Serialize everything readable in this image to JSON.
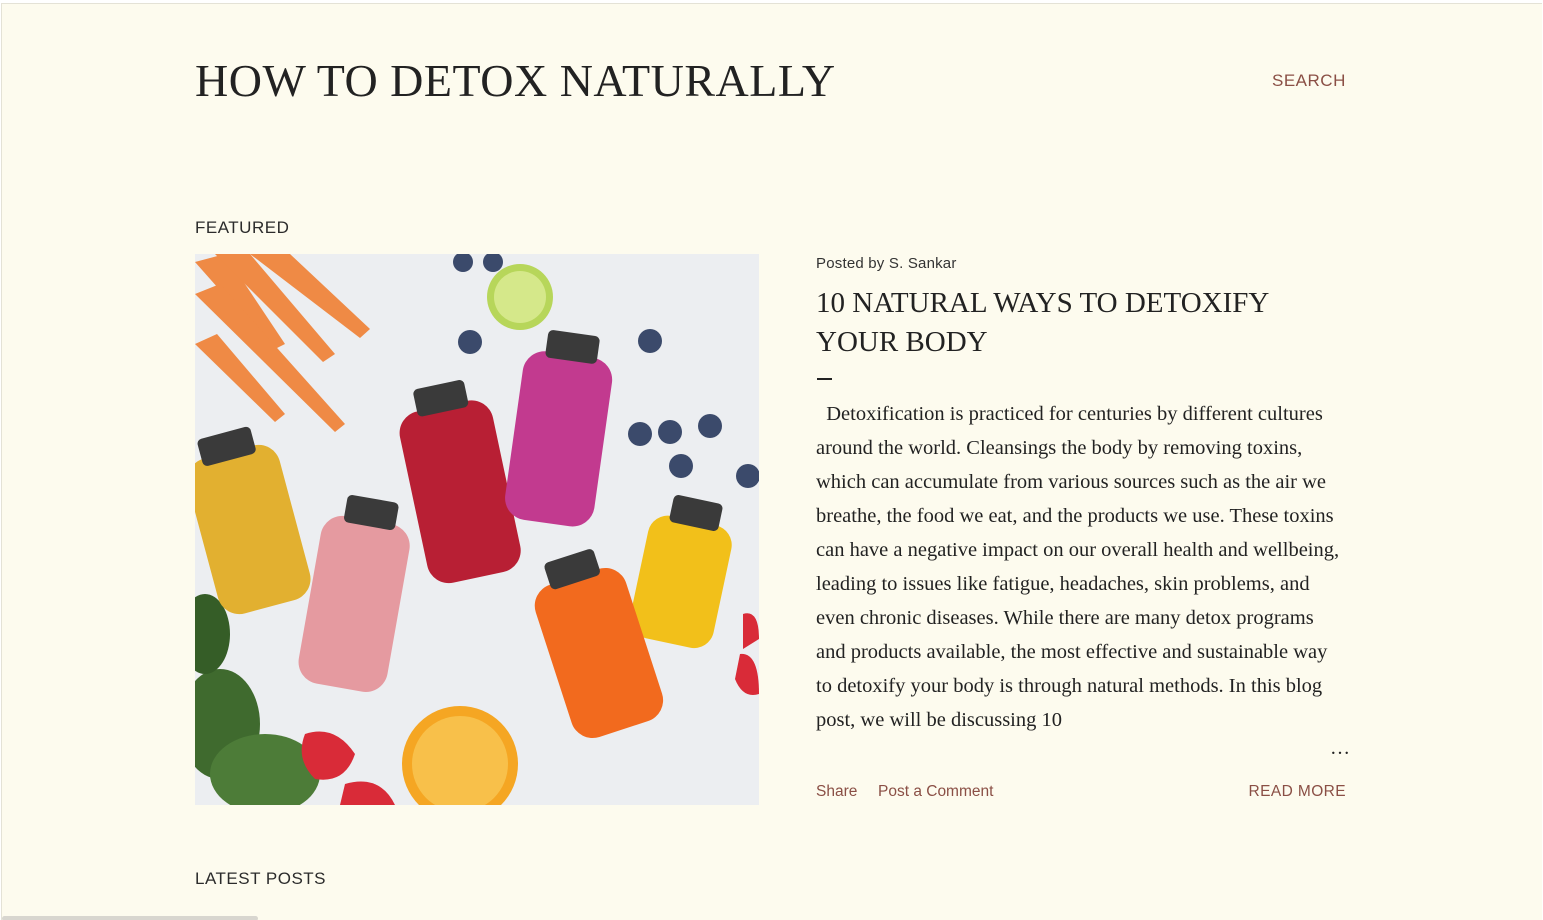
{
  "header": {
    "site_title": "HOW TO DETOX NATURALLY",
    "search_label": "SEARCH"
  },
  "featured": {
    "section_label": "FEATURED",
    "image_icon": "juice-bottles-image",
    "post": {
      "byline": "Posted by S. Sankar",
      "title": "10 NATURAL WAYS TO DETOXIFY YOUR BODY",
      "excerpt": "  Detoxification is practiced for centuries by different cultures around the world. Cleansings the body by removing toxins, which can accumulate from various sources such as the air we breathe, the food we eat, and the products we use. These toxins can have a negative impact on our overall health and wellbeing, leading to issues like fatigue, headaches, skin problems, and even chronic diseases. While there are many detox programs and products available, the most effective and sustainable way to detoxify your body is through natural methods. In this blog post, we will be discussing 10",
      "ellipsis": "…",
      "share_label": "Share",
      "comment_label": "Post a Comment",
      "read_more_label": "READ MORE"
    }
  },
  "latest": {
    "section_label": "LATEST POSTS"
  },
  "colors": {
    "background": "#fdfbee",
    "link": "#8a4f45",
    "text": "#222222"
  }
}
